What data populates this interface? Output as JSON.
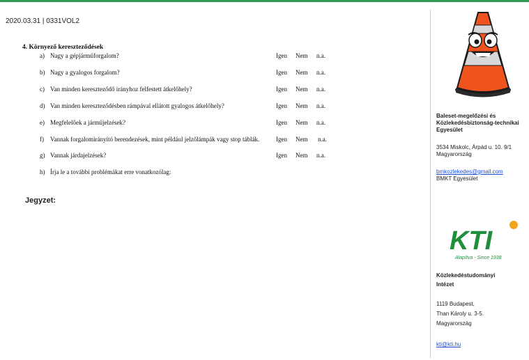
{
  "header": {
    "text": "2020.03.31 | 0331VOL2"
  },
  "section": {
    "title": "4.  Környező kereszteződések"
  },
  "questions": [
    {
      "letter": "a)",
      "text": "Nagy a gépjárműforgalom?"
    },
    {
      "letter": "b)",
      "text": "Nagy a gyalogos forgalom?"
    },
    {
      "letter": "c)",
      "text": "Van minden kereszteződő irányhoz felfestett átkelőhely?"
    },
    {
      "letter": "d)",
      "text": "Van minden kereszteződésben rámpával ellátott gyalogos átkelőhely?"
    },
    {
      "letter": "e)",
      "text": "Megfelelőek a járműjelzések?"
    },
    {
      "letter": "f)",
      "text": "Vannak forgalomirányító berendezések, mint például jelzőlámpák vagy stop táblák."
    },
    {
      "letter": "g)",
      "text": "Vannak járdajelzések?"
    },
    {
      "letter": "h)",
      "text": "Írja le a további problémákat erre vonatkozólag:"
    }
  ],
  "answers": {
    "yes": "Igen",
    "no": "Nem",
    "na": "n.a."
  },
  "jegyzet": "Jegyzet:",
  "sidebar": {
    "org1_line1": "Baleset-megelőzési és",
    "org1_line2": "Közlekedésbiztonság-technikai",
    "org1_line3": "Egyesület",
    "org1_addr1": "3534 Miskolc, Árpád u. 10. 9/1",
    "org1_addr2": "Magyarország",
    "org1_email": "bmkozlekedes@gmail.com",
    "org1_short": "BMKT Egyesület",
    "kti_logo_text": "KTI",
    "kti_tagline": "Alapítva - Since 1938",
    "org2_line1": "Közlekedéstudományi",
    "org2_line2": "Intézet",
    "org2_addr1": "1119 Budapest,",
    "org2_addr2": "Than Károly u. 3-5.",
    "org2_addr3": "Magyarország",
    "org2_email": "kti@kti.hu"
  },
  "colors": {
    "accent_green": "#2e9a55",
    "cone_orange": "#f0541e",
    "kti_green": "#1e8f3a",
    "link_blue": "#1a4fd6"
  }
}
